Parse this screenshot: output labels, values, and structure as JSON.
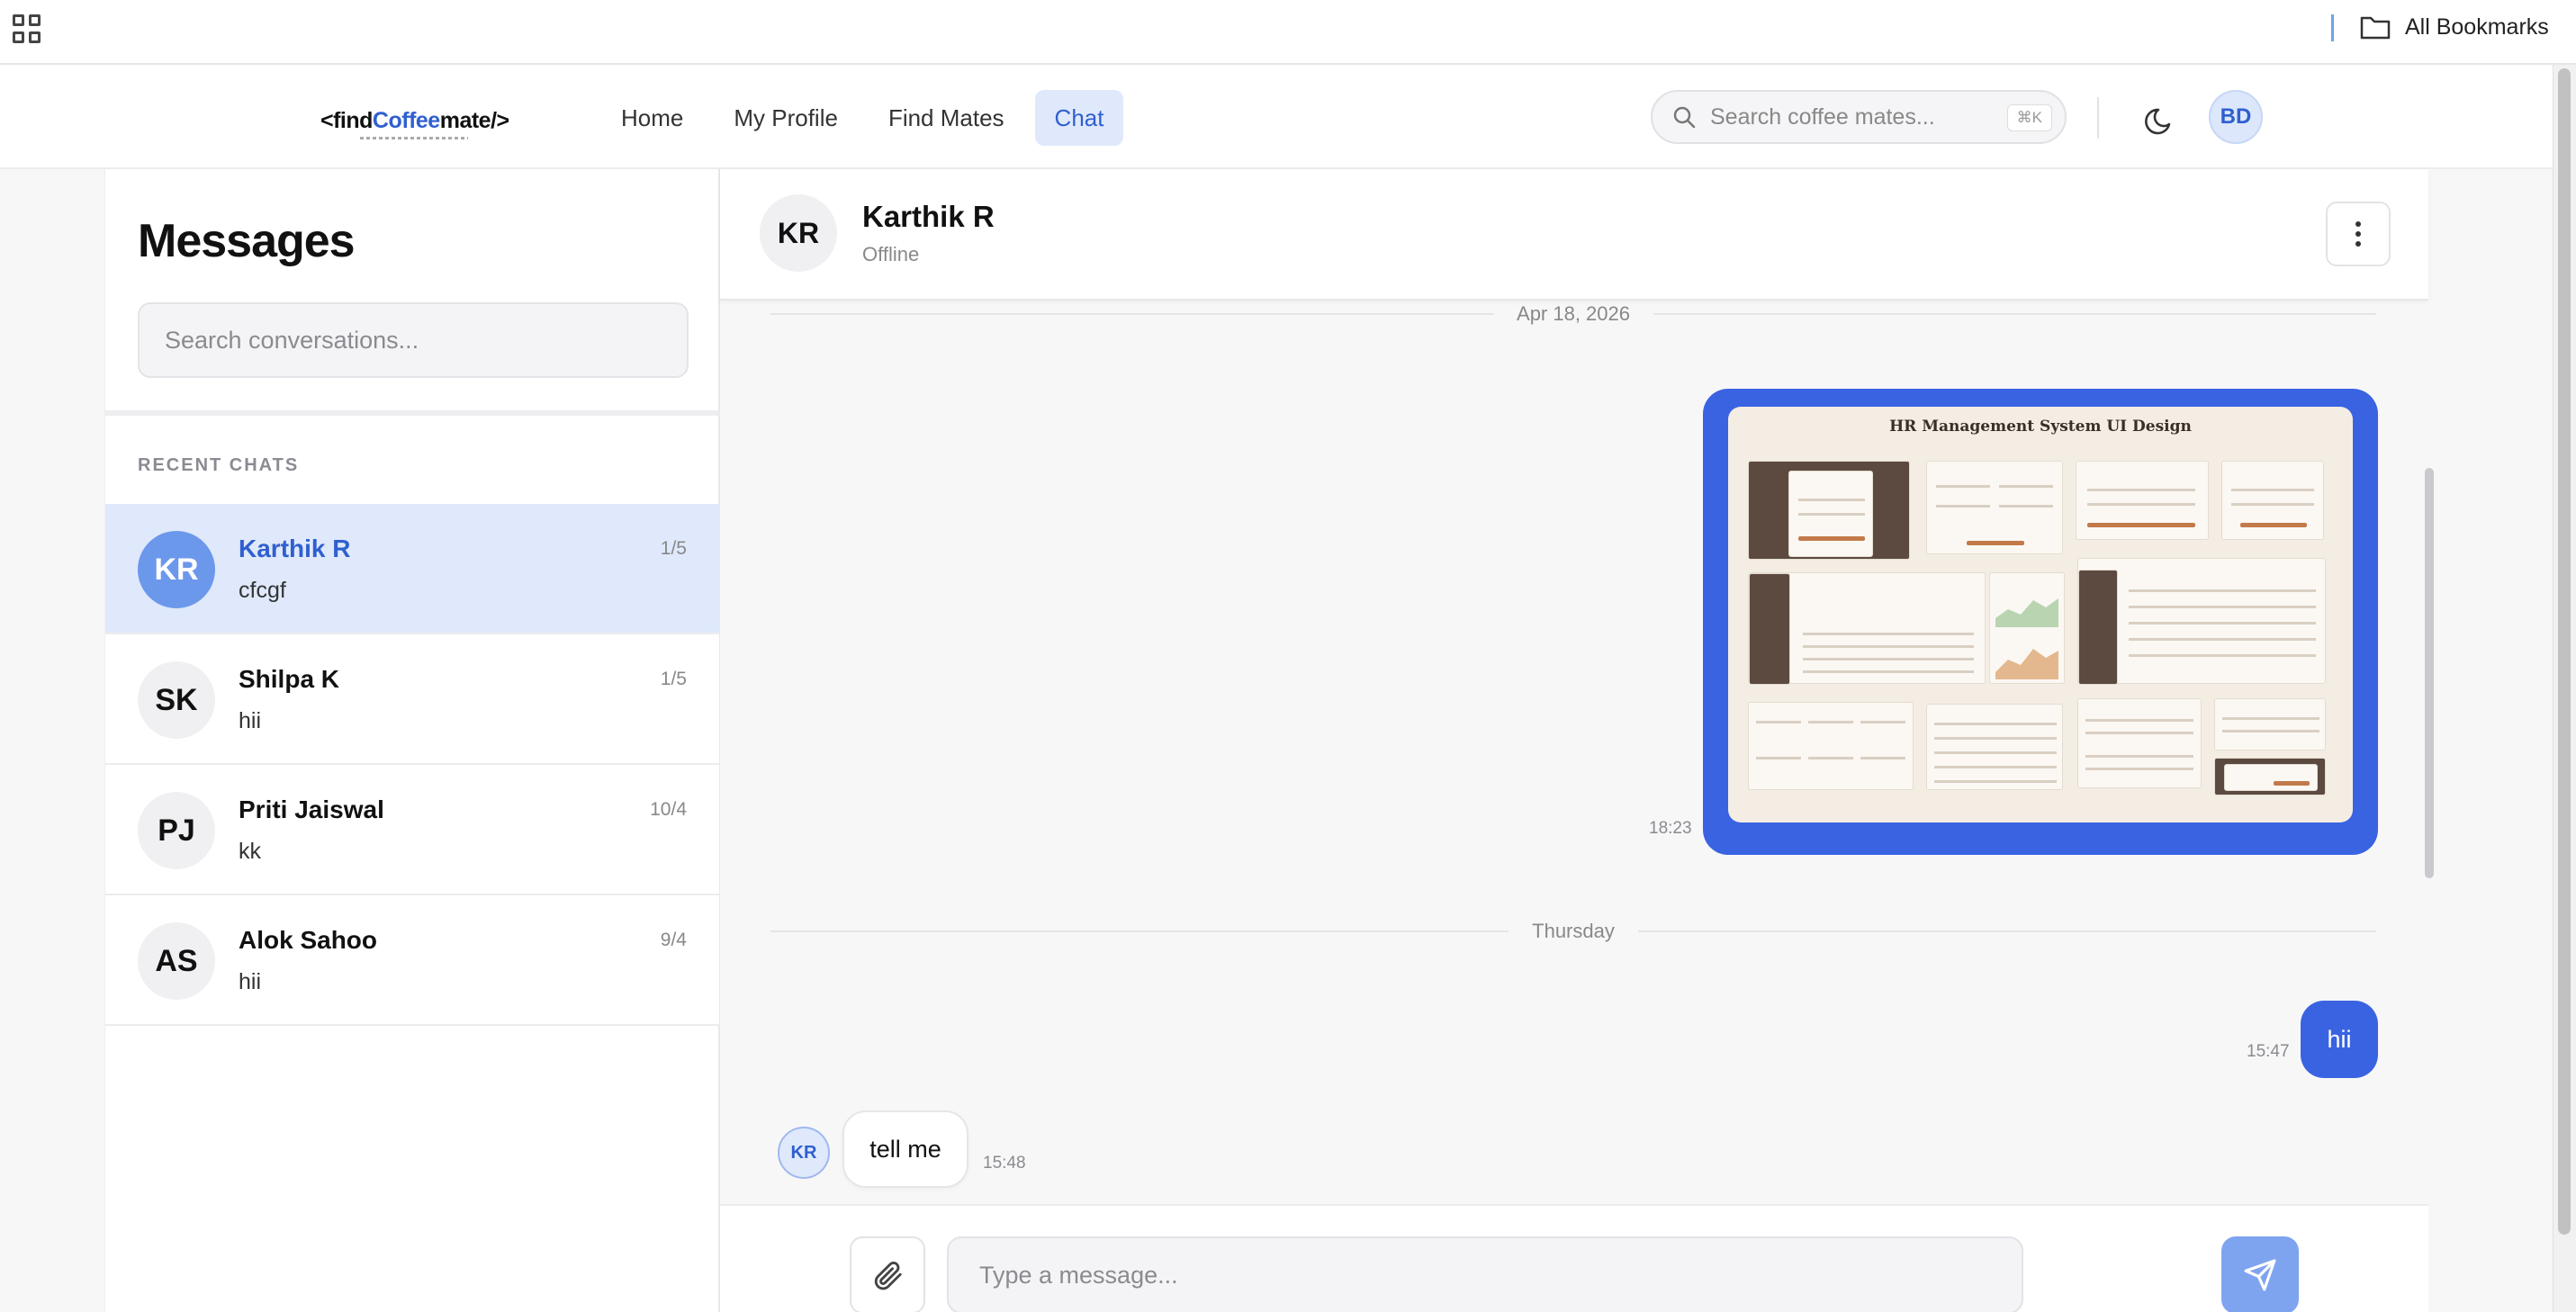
{
  "browser": {
    "bookmarks_folder": "All Bookmarks"
  },
  "header": {
    "logo": {
      "prefix": "<find",
      "accent": "Coffee",
      "suffix": "mate/>"
    },
    "nav": [
      "Home",
      "My Profile",
      "Find Mates",
      "Chat"
    ],
    "active_nav": "Chat",
    "search_placeholder": "Search coffee mates...",
    "search_shortcut": "⌘K",
    "user_initials": "BD"
  },
  "sidebar": {
    "title": "Messages",
    "search_placeholder": "Search conversations...",
    "recent_label": "RECENT CHATS",
    "chats": [
      {
        "initials": "KR",
        "name": "Karthik R",
        "preview": "cfcgf",
        "date": "1/5",
        "active": true
      },
      {
        "initials": "SK",
        "name": "Shilpa K",
        "preview": "hii",
        "date": "1/5",
        "active": false
      },
      {
        "initials": "PJ",
        "name": "Priti Jaiswal",
        "preview": "kk",
        "date": "10/4",
        "active": false
      },
      {
        "initials": "AS",
        "name": "Alok Sahoo",
        "preview": "hii",
        "date": "9/4",
        "active": false
      }
    ]
  },
  "chat": {
    "contact_initials": "KR",
    "contact_name": "Karthik R",
    "contact_status": "Offline",
    "date_divider_1": "Apr 18, 2026",
    "image_message": {
      "title": "HR Management System UI Design",
      "time": "18:23"
    },
    "date_divider_2": "Thursday",
    "outgoing": {
      "text": "hii",
      "time": "15:47"
    },
    "incoming": {
      "initials": "KR",
      "text": "tell me",
      "time": "15:48"
    },
    "composer_placeholder": "Type a message..."
  },
  "colors": {
    "accent": "#3a63e2",
    "active_bg": "#dfe9fb",
    "logo_accent": "#2f5fd0"
  }
}
